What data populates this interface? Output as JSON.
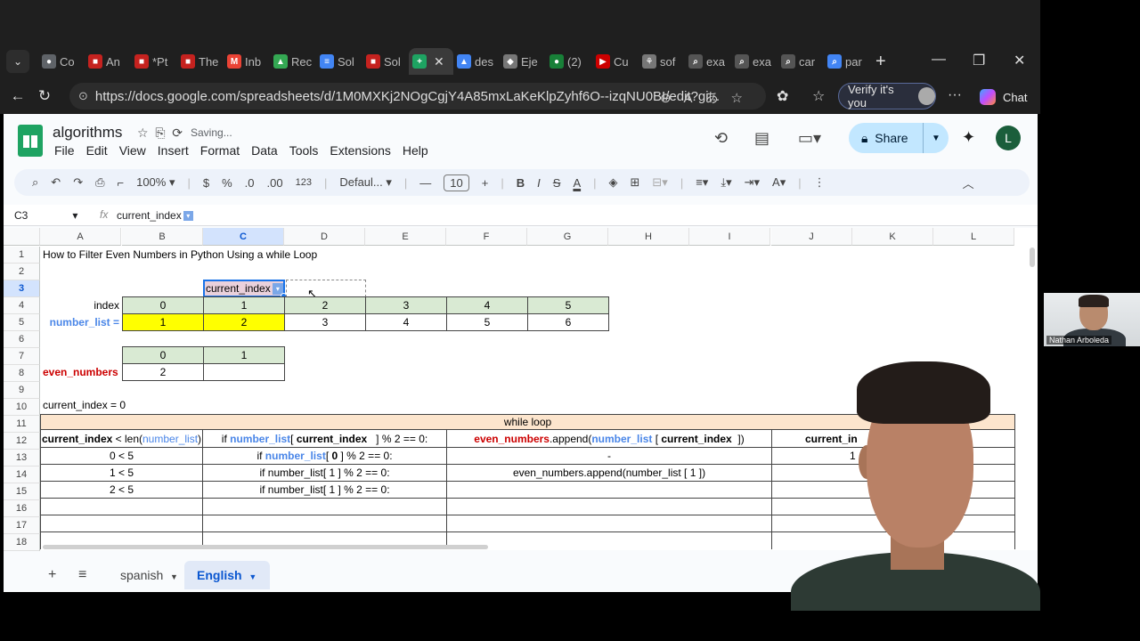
{
  "browser": {
    "tabs": [
      {
        "label": "Co",
        "color": "#5f6368",
        "glyph": "●"
      },
      {
        "label": "An",
        "color": "#c5221f",
        "glyph": "■"
      },
      {
        "label": "*Pt",
        "color": "#c5221f",
        "glyph": "■"
      },
      {
        "label": "The",
        "color": "#c5221f",
        "glyph": "■"
      },
      {
        "label": "Inb",
        "color": "#ea4335",
        "glyph": "M"
      },
      {
        "label": "Rec",
        "color": "#34a853",
        "glyph": "▲"
      },
      {
        "label": "Sol",
        "color": "#4285f4",
        "glyph": "≡"
      },
      {
        "label": "Sol",
        "color": "#c5221f",
        "glyph": "■"
      }
    ],
    "active_tab": {
      "label": "",
      "color": "#1ea362",
      "glyph": "+"
    },
    "tabs_after": [
      {
        "label": "des",
        "color": "#4285f4",
        "glyph": "▲"
      },
      {
        "label": "Eje",
        "color": "#777777",
        "glyph": "◆"
      },
      {
        "label": "(2)",
        "color": "#188038",
        "glyph": "●"
      },
      {
        "label": "Cu",
        "color": "#cc0000",
        "glyph": "▶"
      },
      {
        "label": "sof",
        "color": "#777777",
        "glyph": "⚘"
      },
      {
        "label": "exa",
        "color": "#555555",
        "glyph": "⌕"
      },
      {
        "label": "exa",
        "color": "#555555",
        "glyph": "⌕"
      },
      {
        "label": "car",
        "color": "#555555",
        "glyph": "⌕"
      },
      {
        "label": "par",
        "color": "#4285f4",
        "glyph": "⌕"
      }
    ],
    "url": "https://docs.google.com/spreadsheets/d/1M0MXKj2NOgCgjY4A85mxLaKeKlpZyhf6O--izqNU0BI/edit?gi...",
    "verify_label": "Verify it's you",
    "chat_label": "Chat"
  },
  "sheets": {
    "title": "algorithms",
    "saving": "Saving...",
    "menu": [
      "File",
      "Edit",
      "View",
      "Insert",
      "Format",
      "Data",
      "Tools",
      "Extensions",
      "Help"
    ],
    "share_label": "Share",
    "avatar_letter": "L",
    "toolbar": {
      "zoom": "100%",
      "currency": "$",
      "percent": "%",
      "dec_minus": ".0",
      "dec_plus": ".00",
      "numfmt": "123",
      "font": "Defaul...",
      "font_size": "10"
    },
    "name_box": "C3",
    "formula": "current_index",
    "columns": [
      "A",
      "B",
      "C",
      "D",
      "E",
      "F",
      "G",
      "H",
      "I",
      "J",
      "K",
      "L"
    ],
    "rows": [
      "1",
      "2",
      "3",
      "4",
      "5",
      "6",
      "7",
      "8",
      "9",
      "10",
      "11",
      "12",
      "13",
      "14",
      "15",
      "16",
      "17",
      "18"
    ],
    "cells": {
      "a1": "How to Filter Even Numbers in Python Using a while Loop",
      "c3": "current_index",
      "a4": "index",
      "index_values": [
        "0",
        "1",
        "2",
        "3",
        "4",
        "5"
      ],
      "a5": "number_list =",
      "number_values": [
        "1",
        "2",
        "3",
        "4",
        "5",
        "6"
      ],
      "even_index": [
        "0",
        "1"
      ],
      "a8": "even_numbers",
      "even_values": [
        "2",
        ""
      ],
      "a10": "current_index = 0",
      "while_header": "while loop",
      "h12_a_bold": "current_index",
      "h12_a_rest": " < len(",
      "h12_a_blue": "number_list",
      "h12_a_close": ")",
      "h12_b_pre": "if ",
      "h12_b_blue": "number_list",
      "h12_b_bracket": "[ ",
      "h12_b_bold": "current_index",
      "h12_b_post": "   ] % 2 == 0:",
      "h12_c_red": "even_numbers",
      "h12_c_mid": ".append(",
      "h12_c_blue": "number_list",
      "h12_c_bracket": " [ ",
      "h12_c_bold": "current_index",
      "h12_c_post": "  ])",
      "h12_d": "current_in",
      "r13_a": "0 < 5",
      "r13_b_pre": "if ",
      "r13_b_blue": "number_list",
      "r13_b_bracket": "[ ",
      "r13_b_bold": "0",
      "r13_b_post": " ] % 2 == 0:",
      "r13_c": "-",
      "r13_d": "1",
      "r14_a": "1 < 5",
      "r14_b": "if number_list[ 1 ] % 2 == 0:",
      "r14_c": "even_numbers.append(number_list [ 1 ])",
      "r15_a": "2 < 5",
      "r15_b": "if number_list[ 1 ] % 2 == 0:"
    },
    "sheet_tabs": [
      "spanish",
      "English"
    ],
    "active_sheet": "English"
  },
  "video": {
    "participant": "Nathan Arboleda"
  }
}
